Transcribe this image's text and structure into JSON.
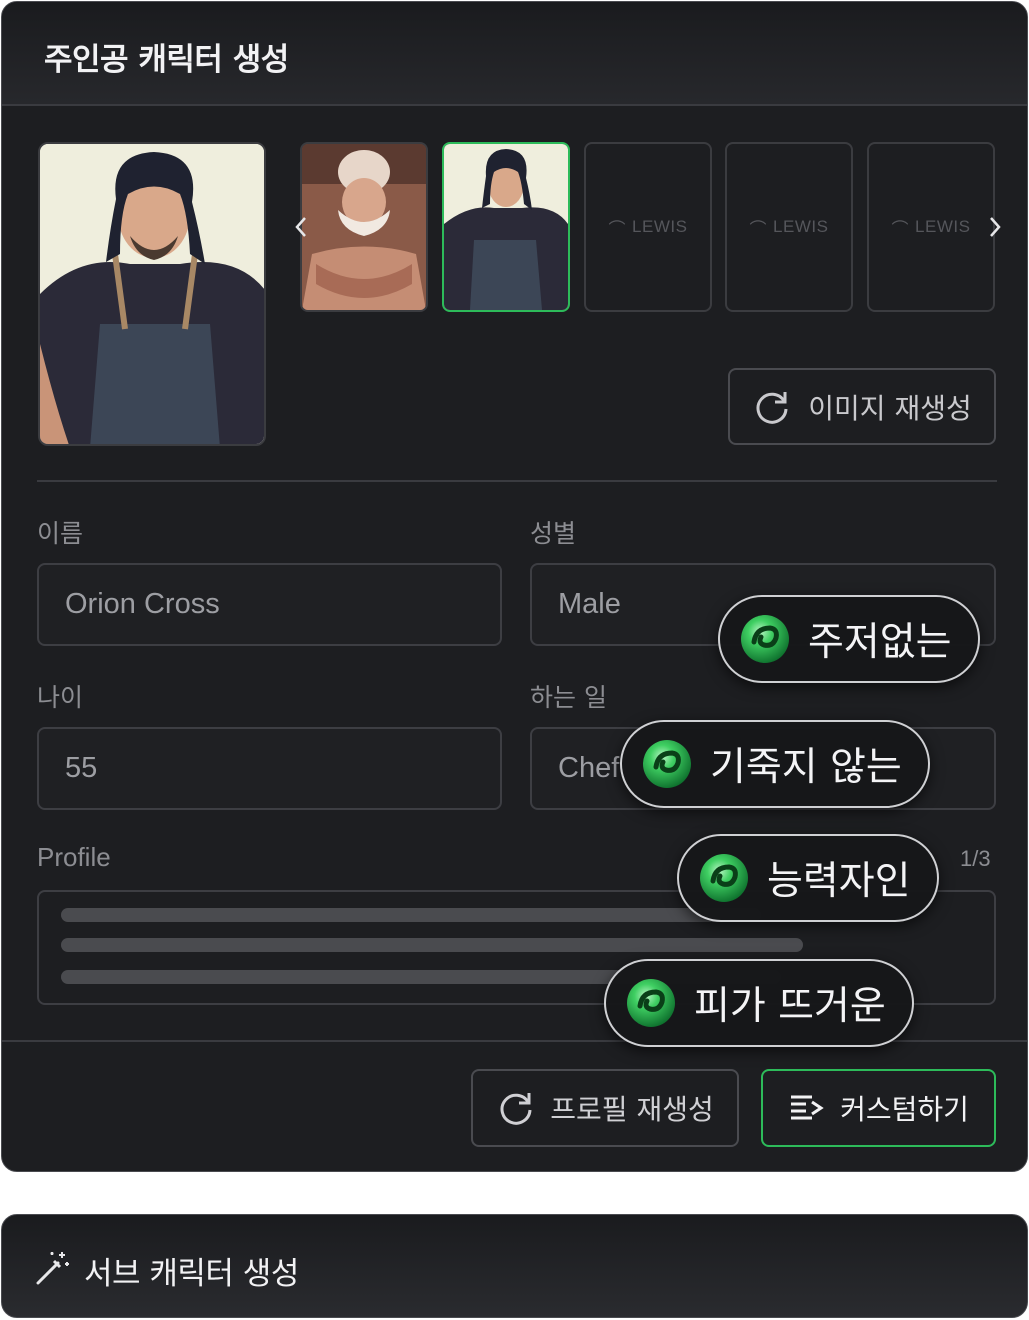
{
  "main_panel": {
    "title": "주인공 캐릭터 생성",
    "thumbnails": [
      {
        "kind": "image",
        "subject": "bearded chef",
        "selected": false
      },
      {
        "kind": "image",
        "subject": "long-haired man in apron",
        "selected": true
      },
      {
        "kind": "placeholder",
        "label": "LEWIS",
        "selected": false
      },
      {
        "kind": "placeholder",
        "label": "LEWIS",
        "selected": false
      },
      {
        "kind": "placeholder",
        "label": "LEWIS",
        "selected": false
      }
    ],
    "regenerate_image_label": "이미지 재생성",
    "fields": {
      "name": {
        "label": "이름",
        "value": "Orion Cross"
      },
      "gender": {
        "label": "성별",
        "value": "Male"
      },
      "age": {
        "label": "나이",
        "value": "55"
      },
      "job": {
        "label": "하는 일",
        "value": "Chef"
      }
    },
    "profile": {
      "label": "Profile",
      "counter": "1/3"
    },
    "regenerate_profile_label": "프로필 재생성",
    "customize_label": "커스텀하기"
  },
  "trait_chips": [
    "주저없는",
    "기죽지 않는",
    "능력자인",
    "피가 뜨거운"
  ],
  "sub_panel": {
    "title": "서브 캐릭터 생성"
  },
  "colors": {
    "accent": "#2dbb5a",
    "panel_bg": "#1d1e21",
    "border": "#3d3e43"
  },
  "icons": {
    "prev": "chevron-left-icon",
    "next": "chevron-right-icon",
    "refresh": "refresh-icon",
    "customize": "list-edit-icon",
    "magic": "magic-wand-icon",
    "chip": "swirl-icon"
  }
}
